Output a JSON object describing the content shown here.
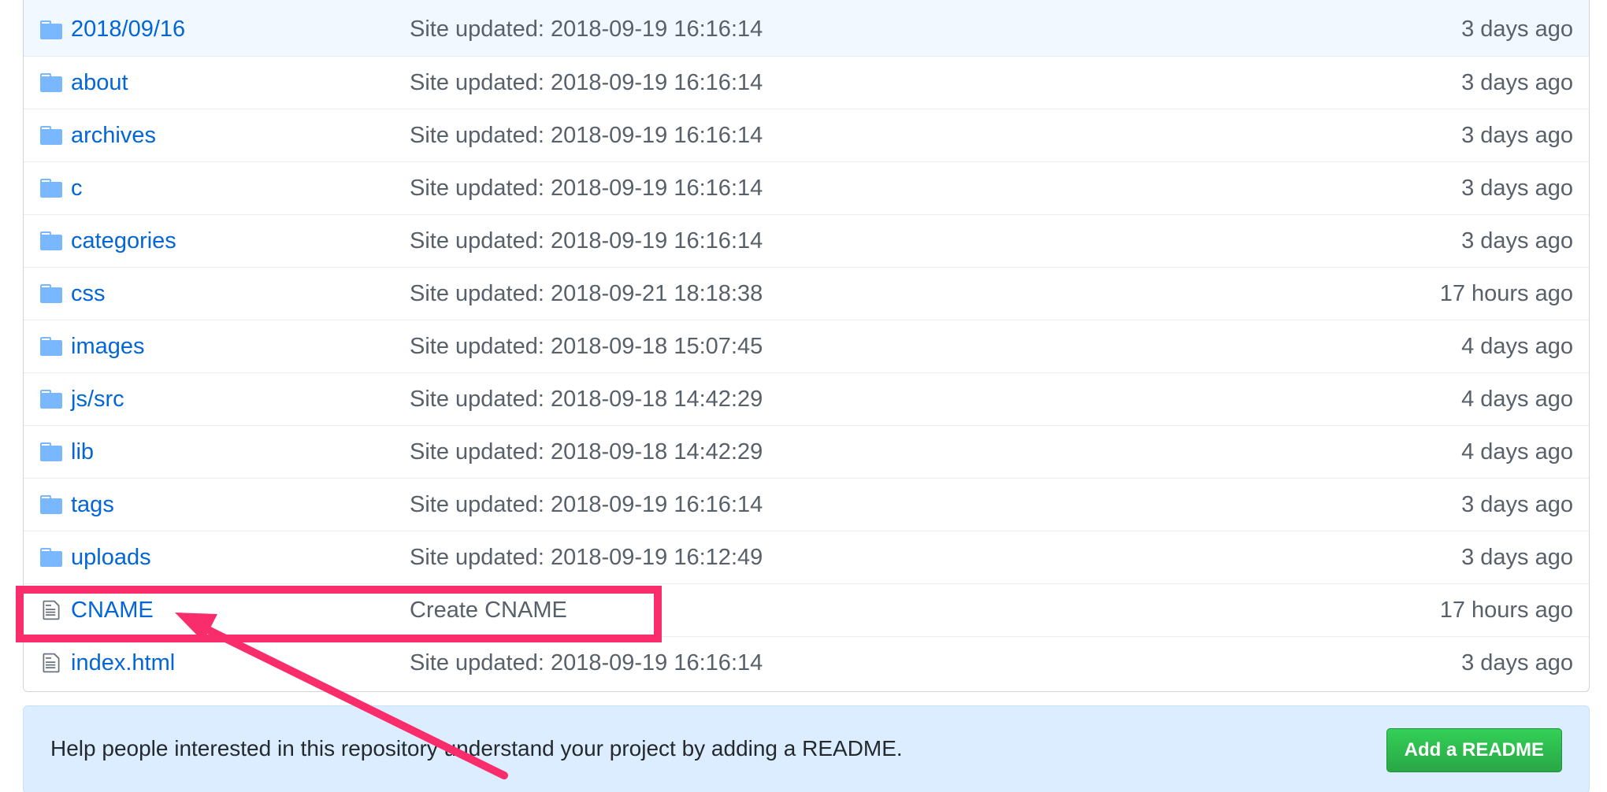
{
  "files": [
    {
      "name": "2018/09/16",
      "type": "folder",
      "message": "Site updated: 2018-09-19 16:16:14",
      "age": "3 days ago"
    },
    {
      "name": "about",
      "type": "folder",
      "message": "Site updated: 2018-09-19 16:16:14",
      "age": "3 days ago"
    },
    {
      "name": "archives",
      "type": "folder",
      "message": "Site updated: 2018-09-19 16:16:14",
      "age": "3 days ago"
    },
    {
      "name": "c",
      "type": "folder",
      "message": "Site updated: 2018-09-19 16:16:14",
      "age": "3 days ago"
    },
    {
      "name": "categories",
      "type": "folder",
      "message": "Site updated: 2018-09-19 16:16:14",
      "age": "3 days ago"
    },
    {
      "name": "css",
      "type": "folder",
      "message": "Site updated: 2018-09-21 18:18:38",
      "age": "17 hours ago"
    },
    {
      "name": "images",
      "type": "folder",
      "message": "Site updated: 2018-09-18 15:07:45",
      "age": "4 days ago"
    },
    {
      "name": "js/src",
      "type": "folder",
      "message": "Site updated: 2018-09-18 14:42:29",
      "age": "4 days ago"
    },
    {
      "name": "lib",
      "type": "folder",
      "message": "Site updated: 2018-09-18 14:42:29",
      "age": "4 days ago"
    },
    {
      "name": "tags",
      "type": "folder",
      "message": "Site updated: 2018-09-19 16:16:14",
      "age": "3 days ago"
    },
    {
      "name": "uploads",
      "type": "folder",
      "message": "Site updated: 2018-09-19 16:12:49",
      "age": "3 days ago"
    },
    {
      "name": "CNAME",
      "type": "file",
      "message": "Create CNAME",
      "age": "17 hours ago"
    },
    {
      "name": "index.html",
      "type": "file",
      "message": "Site updated: 2018-09-19 16:16:14",
      "age": "3 days ago"
    }
  ],
  "readme_banner": {
    "text": "Help people interested in this repository understand your project by adding a README.",
    "button_label": "Add a README"
  },
  "annotation": {
    "highlight_color": "#fa2d6c",
    "highlighted_file": "CNAME"
  },
  "colors": {
    "link": "#0366d6",
    "muted": "#586069",
    "icon": "#6a737d",
    "button_green": "#28a745",
    "banner_bg": "#dbedff"
  }
}
